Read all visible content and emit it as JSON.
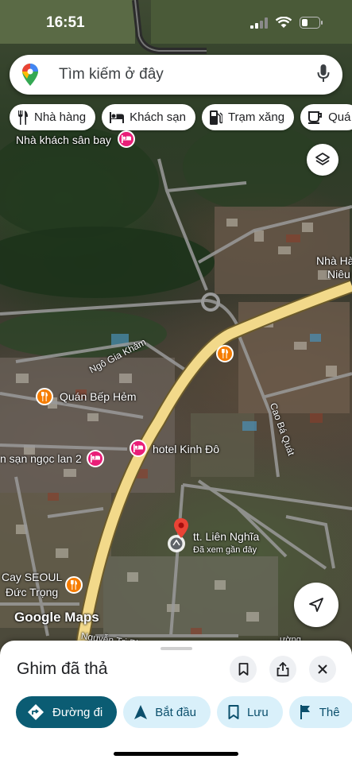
{
  "status": {
    "time": "16:51"
  },
  "search": {
    "placeholder": "Tìm kiếm ở đây"
  },
  "chips": [
    {
      "label": "Nhà hàng",
      "icon": "restaurant-icon"
    },
    {
      "label": "Khách sạn",
      "icon": "hotel-icon"
    },
    {
      "label": "Trạm xăng",
      "icon": "gas-station-icon"
    },
    {
      "label": "Quá",
      "icon": "cafe-icon"
    }
  ],
  "map": {
    "labels": {
      "nha_khach_san_bay": "Nhà khách sân bay",
      "nha_hang_1": "Nhà Hà",
      "nha_hang_2": "Niêu",
      "quan_bep_hem": "Quán Bếp Hẻm",
      "khach_san_ngoc_lan": "n sạn ngọc lan 2",
      "hotel_kinh_do": "hotel Kinh Đô",
      "cay_seoul": "Cay SEOUL",
      "duc_trong": "Đức Trọng",
      "pin_name": "tt. Liên Nghĩa",
      "pin_sub": "Đã xem gần đây"
    },
    "streets": {
      "ngo_gia_kham": "Ngô Gia Khảm",
      "cao_ba_quat": "Cao Bá Quát",
      "nguyen_tri_phuong": "Nguyễn Tri Phương",
      "partial": "ường"
    },
    "attribution": "Google Maps"
  },
  "sheet": {
    "title": "Ghim đã thả",
    "actions": [
      {
        "label": "Đường đi",
        "icon": "directions-icon"
      },
      {
        "label": "Bắt đầu",
        "icon": "navigation-arrow-icon"
      },
      {
        "label": "Lưu",
        "icon": "bookmark-icon"
      },
      {
        "label": "Thê",
        "icon": "flag-icon"
      }
    ]
  },
  "colors": {
    "primary_action": "#0b5c73",
    "secondary_action_bg": "#d9f0fa",
    "pin_red": "#ea4335",
    "food_poi": "#f57c00",
    "hotel_poi": "#e91e78",
    "main_road": "#f2d98a"
  }
}
